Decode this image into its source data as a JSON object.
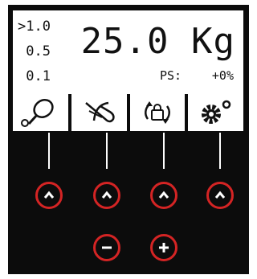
{
  "display": {
    "step_options": [
      ">1.0",
      " 0.5",
      " 0.1"
    ],
    "weight": "25.0 Kg",
    "ps_label": "PS:",
    "ps_value": "+0%"
  },
  "icons": [
    "racket-icon",
    "string-cut-icon",
    "rotate-lock-icon",
    "settings-gear-icon"
  ],
  "colors": {
    "panel": "#0c0c0c",
    "lcd": "#ffffff",
    "button_ring": "#d42424"
  }
}
